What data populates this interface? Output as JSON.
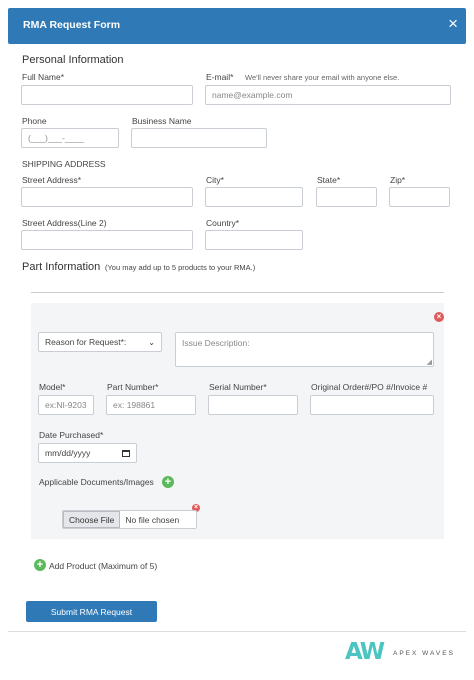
{
  "header": {
    "title": "RMA Request Form",
    "close_symbol": "×"
  },
  "personal": {
    "heading": "Personal Information",
    "full_name_label": "Full Name*",
    "email_label": "E-mail*",
    "email_hint": "We'll never share your email with anyone else.",
    "email_placeholder": "name@example.com",
    "phone_label": "Phone",
    "phone_placeholder": "(___)___-____",
    "business_label": "Business Name"
  },
  "shipping": {
    "heading": "SHIPPING ADDRESS",
    "street_label": "Street Address*",
    "city_label": "City*",
    "state_label": "State*",
    "zip_label": "Zip*",
    "street2_label": "Street Address(Line 2)",
    "country_label": "Country*"
  },
  "part": {
    "heading": "Part Information",
    "hint": "(You may add up to 5 products to your RMA.)",
    "reason_select": "Reason for Request*:",
    "issue_placeholder": "Issue Description:",
    "model_label": "Model*",
    "model_placeholder": "ex:NI-9203",
    "part_label": "Part Number*",
    "part_placeholder": "ex: 198861",
    "serial_label": "Serial Number*",
    "order_label": "Original Order#/PO #/Invoice #",
    "date_label": "Date Purchased*",
    "date_placeholder": "mm/dd/yyyy",
    "docs_label": "Applicable Documents/Images",
    "choose_file": "Choose File",
    "no_file": "No file chosen"
  },
  "add_product": "Add Product (Maximum of 5)",
  "submit": "Submit RMA Request",
  "logo": {
    "mark": "AW",
    "text": "APEX WAVES"
  },
  "colors": {
    "primary": "#2f79b6",
    "danger": "#e05a5a",
    "success": "#5cb85c",
    "panel": "#f4f5f7"
  }
}
